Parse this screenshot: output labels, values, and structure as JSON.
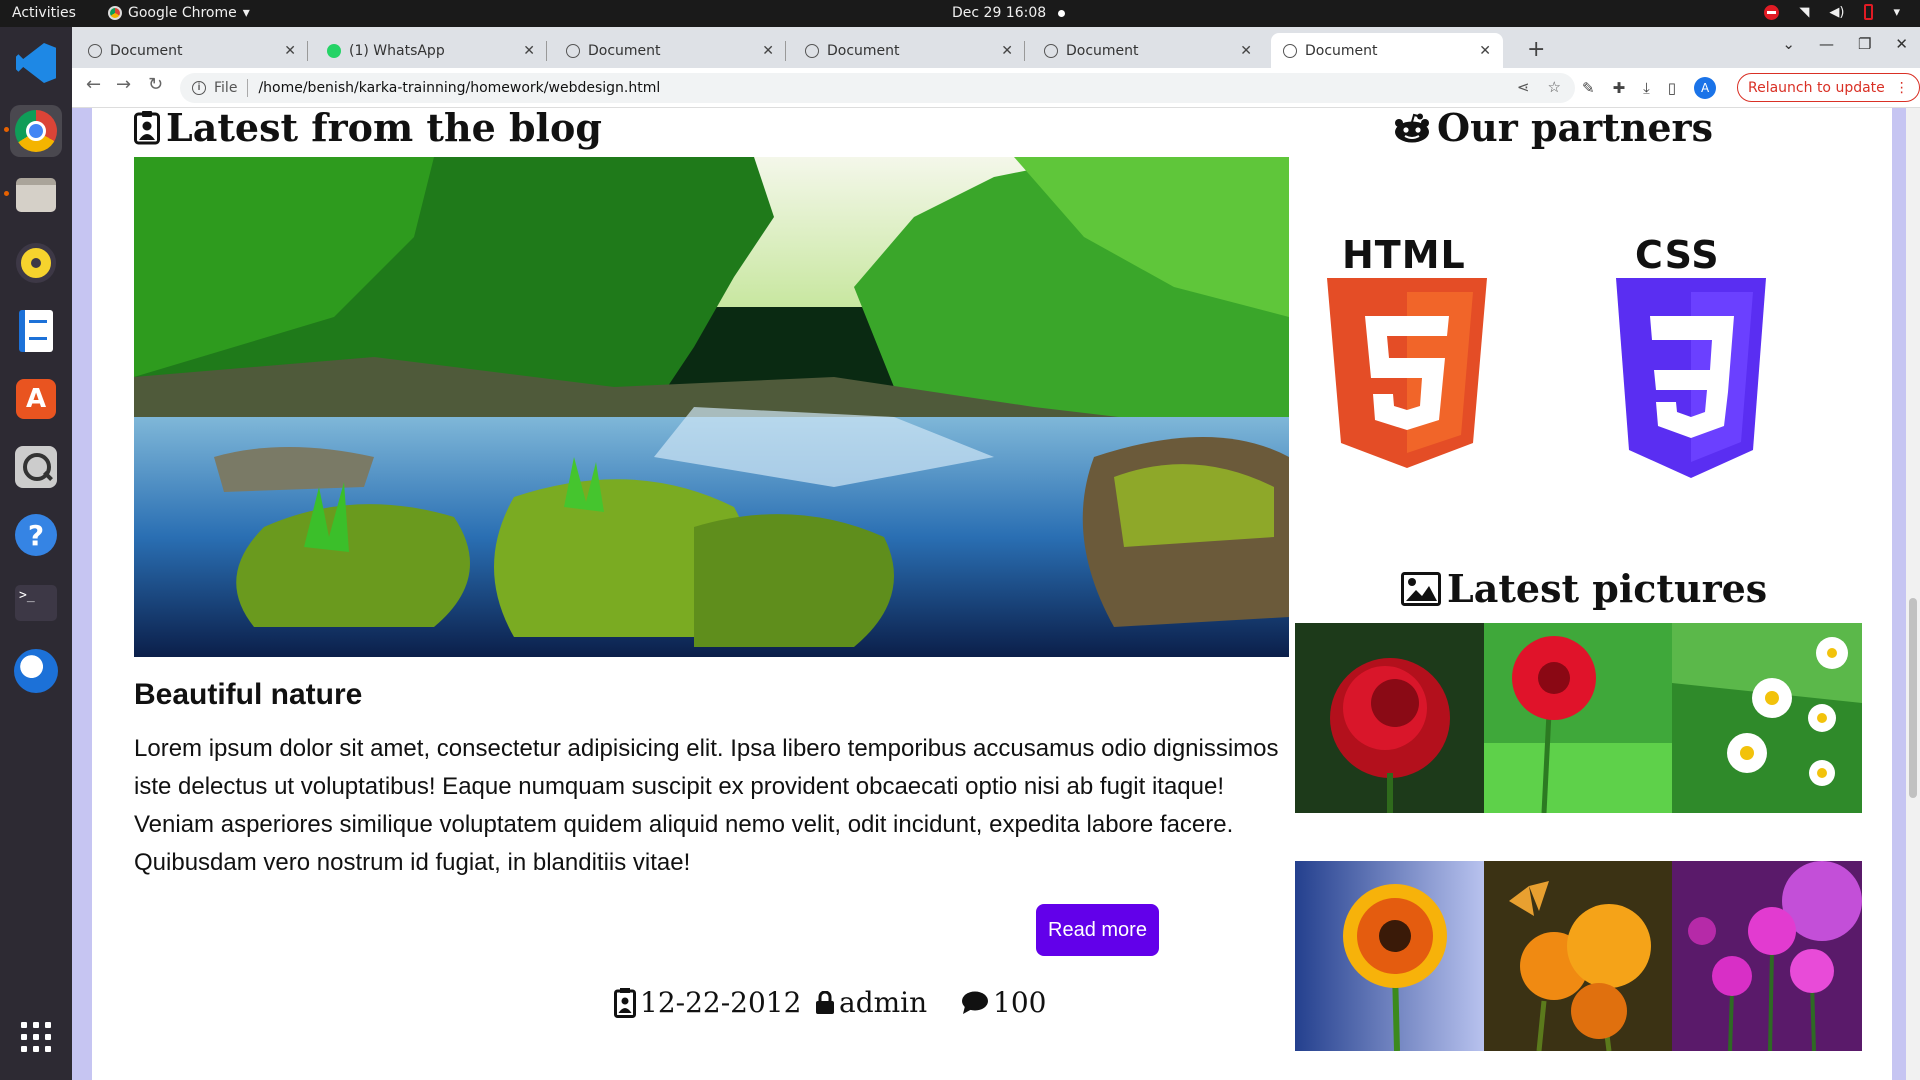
{
  "os": {
    "activities": "Activities",
    "app_name": "Google Chrome",
    "clock": "Dec 29  16:08"
  },
  "browser": {
    "tabs": [
      {
        "title": "Document",
        "active": false
      },
      {
        "title": "(1) WhatsApp",
        "active": false
      },
      {
        "title": "Document",
        "active": false
      },
      {
        "title": "Document",
        "active": false
      },
      {
        "title": "Document",
        "active": false
      },
      {
        "title": "Document",
        "active": true
      }
    ],
    "address": {
      "scheme": "File",
      "url": "/home/benish/karka-trainning/homework/webdesign.html"
    },
    "relaunch_label": "Relaunch to update",
    "profile_initial": "A"
  },
  "page": {
    "blog": {
      "heading": "Latest from the blog",
      "article_title": "Beautiful nature",
      "article_body": "Lorem ipsum dolor sit amet, consectetur adipisicing elit. Ipsa libero temporibus accusamus odio dignissimos iste delectus ut voluptatibus! Eaque numquam suscipit ex provident obcaecati optio nisi ab fugit itaque! Veniam asperiores similique voluptatem quidem aliquid nemo velit, odit incidunt, expedita labore facere. Quibusdam vero nostrum id fugiat, in blanditiis vitae!",
      "read_more": "Read more",
      "meta": {
        "date": "12-22-2012",
        "author": "admin",
        "comments": "100"
      }
    },
    "partners": {
      "heading": "Our partners",
      "logos": [
        {
          "label": "HTML",
          "number": "5",
          "color": "#e44d26"
        },
        {
          "label": "CSS",
          "number": "3",
          "color": "#5a2ef2"
        }
      ]
    },
    "pictures": {
      "heading": "Latest pictures",
      "items": [
        "red-rose",
        "red-daisy",
        "white-daisies",
        "orange-gerbera",
        "orange-flowers-butterfly",
        "purple-globe-flowers"
      ]
    }
  }
}
